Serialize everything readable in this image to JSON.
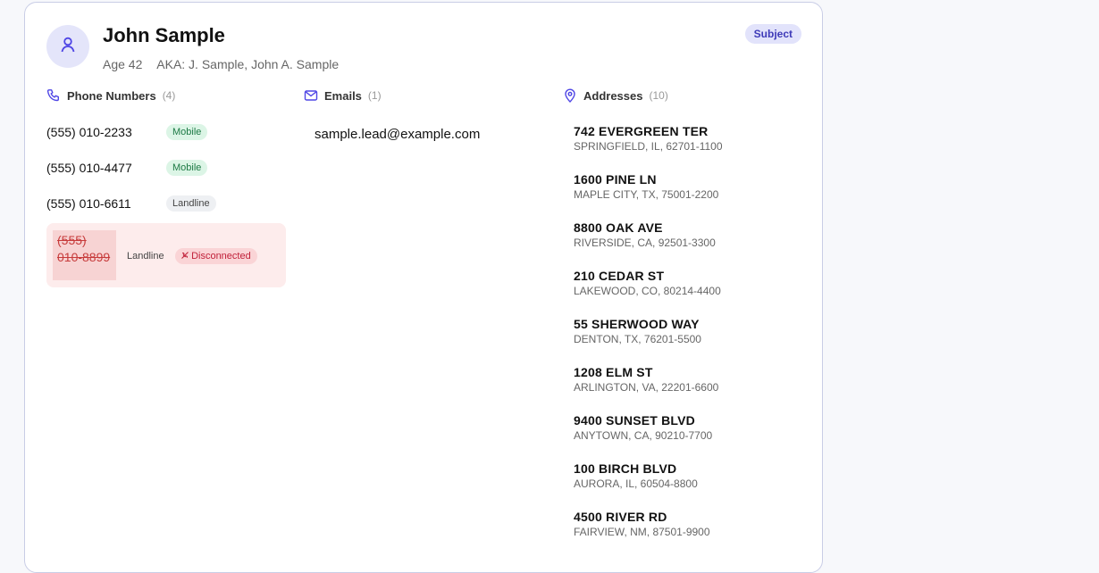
{
  "profile": {
    "name": "John Sample",
    "age": "Age 42",
    "aka": "AKA: J. Sample, John A. Sample",
    "badge": "Subject"
  },
  "phones": {
    "title": "Phone Numbers",
    "count": "(4)",
    "items": [
      {
        "number": "(555) 010-2233",
        "type": "Mobile"
      },
      {
        "number": "(555) 010-4477",
        "type": "Mobile"
      },
      {
        "number": "(555) 010-6611",
        "type": "Landline"
      },
      {
        "number": "(555) 010-8899",
        "type": "Landline",
        "status": "Disconnected"
      }
    ]
  },
  "emails": {
    "title": "Emails",
    "count": "(1)",
    "items": [
      "sample.lead@example.com"
    ]
  },
  "addresses": {
    "title": "Addresses",
    "count": "(10)",
    "items": [
      {
        "street": "742 EVERGREEN TER",
        "city": "SPRINGFIELD, IL, 62701-1100"
      },
      {
        "street": "1600 PINE LN",
        "city": "MAPLE CITY, TX, 75001-2200"
      },
      {
        "street": "8800 OAK AVE",
        "city": "RIVERSIDE, CA, 92501-3300"
      },
      {
        "street": "210 CEDAR ST",
        "city": "LAKEWOOD, CO, 80214-4400"
      },
      {
        "street": "55 SHERWOOD WAY",
        "city": "DENTON, TX, 76201-5500"
      },
      {
        "street": "1208 ELM ST",
        "city": "ARLINGTON, VA, 22201-6600"
      },
      {
        "street": "9400 SUNSET BLVD",
        "city": "ANYTOWN, CA, 90210-7700"
      },
      {
        "street": "100 BIRCH BLVD",
        "city": "AURORA, IL, 60504-8800"
      },
      {
        "street": "4500 RIVER RD",
        "city": "FAIRVIEW, NM, 87501-9900"
      }
    ]
  },
  "icons": {
    "avatar": "user-icon",
    "phones": "phone-icon",
    "emails": "mail-icon",
    "addresses": "map-pin-icon",
    "disconnected": "phone-off-icon"
  },
  "colors": {
    "accent": "#4f46e5",
    "mobile": "#1d7a45",
    "disconnected": "#c1213a"
  }
}
